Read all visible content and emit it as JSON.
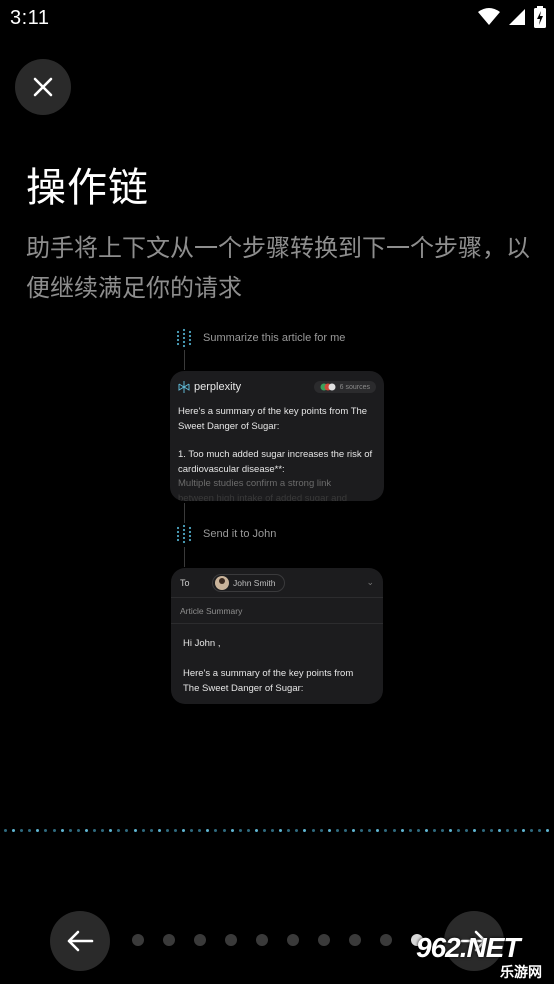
{
  "status_bar": {
    "time": "3:11",
    "icons": [
      "wifi-icon",
      "cellular-signal-icon",
      "battery-charging-icon"
    ]
  },
  "close_button": {
    "icon": "close-icon"
  },
  "title": "操作链",
  "description": "助手将上下文从一个步骤转换到下一个步骤，以便继续满足你的请求",
  "illustration": {
    "step1_text": "Summarize this article for me",
    "perplexity_card": {
      "brand": "perplexity",
      "sources": "6 sources",
      "line1": "Here's a summary of the key points from The Sweet Danger of Sugar:",
      "line2": "1. Too much added sugar increases the risk of cardiovascular disease**:",
      "line3": "Multiple studies confirm a strong link",
      "line4": "between high intake of added sugar and"
    },
    "step2_text": "Send it to John",
    "mail_card": {
      "to_label": "To",
      "recipient": "John Smith",
      "subject": "Article Summary",
      "greeting": "Hi John ,",
      "body": "Here's a summary of the key points from The Sweet Danger of Sugar:"
    }
  },
  "pager": {
    "count": 10,
    "active_index": 9
  },
  "nav": {
    "back_icon": "arrow-left-icon",
    "next_icon": "arrow-right-icon"
  },
  "watermark": {
    "main": "962.NET",
    "sub": "乐游网"
  },
  "colors": {
    "accent": "#5fb6d2",
    "background": "#000000",
    "card": "#1c1c1e"
  }
}
